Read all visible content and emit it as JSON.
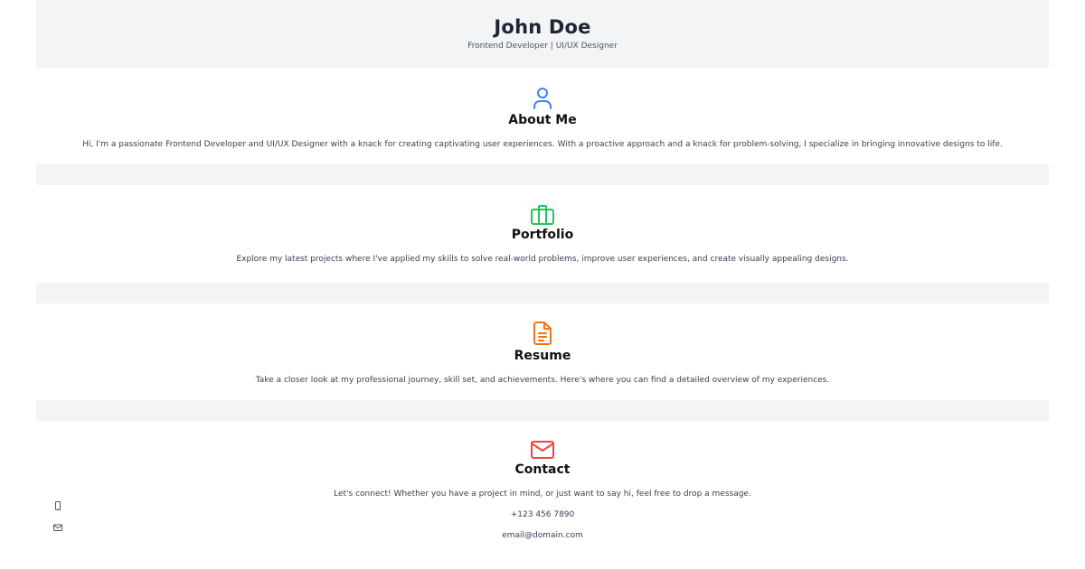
{
  "header": {
    "name": "John Doe",
    "subtitle": "Frontend Developer | UI/UX Designer"
  },
  "sections": {
    "about": {
      "icon": "user-icon",
      "icon_color": "#3b82f6",
      "title": "About Me",
      "text": "Hi, I'm a passionate Frontend Developer and UI/UX Designer with a knack for creating captivating user experiences. With a proactive approach and a knack for problem-solving, I specialize in bringing innovative designs to life."
    },
    "portfolio": {
      "icon": "briefcase-icon",
      "icon_color": "#22c55e",
      "title": "Portfolio",
      "text": "Explore my latest projects where I've applied my skills to solve real-world problems, improve user experiences, and create visually appealing designs."
    },
    "resume": {
      "icon": "document-icon",
      "icon_color": "#f97316",
      "title": "Resume",
      "text": "Take a closer look at my professional journey, skill set, and achievements. Here's where you can find a detailed overview of my experiences."
    },
    "contact": {
      "icon": "envelope-icon",
      "icon_color": "#ef4444",
      "title": "Contact",
      "text": "Let's connect! Whether you have a project in mind, or just want to say hi, feel free to drop a message.",
      "phone": "+123 456 7890",
      "email": "email@domain.com"
    }
  },
  "side_icons": [
    "phone-icon",
    "mail-icon"
  ]
}
